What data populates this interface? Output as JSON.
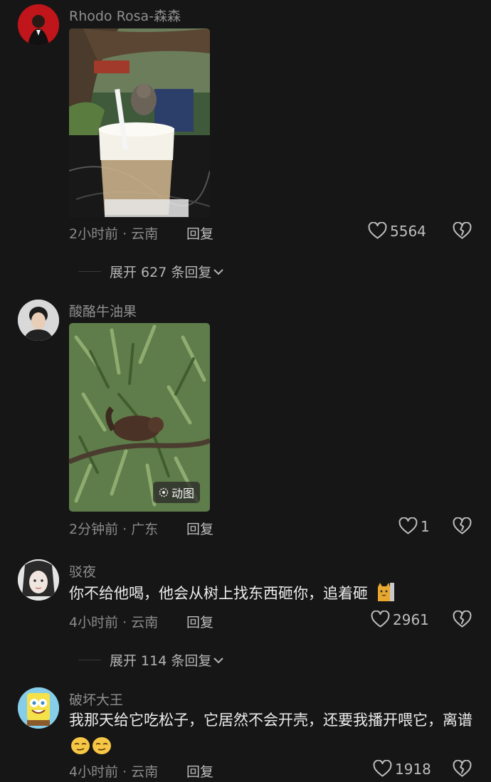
{
  "colors": {
    "background": "#161616",
    "secondary_text": "#8a8a8a"
  },
  "comments": [
    {
      "username": "Rhodo Rosa-森森",
      "image_alt": "latte-with-squirrel-photo",
      "time_location": "2小时前 · 云南",
      "reply_label": "回复",
      "likes": "5564",
      "expand_label": "展开 627 条回复"
    },
    {
      "username": "酸酪牛油果",
      "image_alt": "squirrel-on-branch-gif",
      "gif_label": "动图",
      "time_location": "2分钟前 · 广东",
      "reply_label": "回复",
      "likes": "1"
    },
    {
      "username": "驳夜",
      "text": "你不给他喝，他会从树上找东西砸你，追着砸",
      "time_location": "4小时前 · 云南",
      "reply_label": "回复",
      "likes": "2961",
      "expand_label": "展开 114 条回复"
    },
    {
      "username": "破坏大王",
      "text": "我那天给它吃松子，它居然不会开壳，还要我播开喂它，离谱",
      "time_location": "4小时前 · 云南",
      "reply_label": "回复",
      "likes": "1918"
    }
  ]
}
